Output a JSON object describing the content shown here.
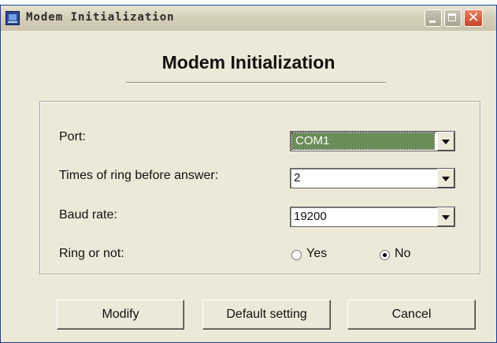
{
  "window": {
    "title": "Modem Initialization"
  },
  "heading": "Modem Initialization",
  "form": {
    "port": {
      "label": "Port:",
      "value": "COM1"
    },
    "rings": {
      "label": "Times of ring before answer:",
      "value": "2"
    },
    "baud": {
      "label": "Baud rate:",
      "value": "19200"
    },
    "ring": {
      "label": "Ring or not:",
      "yes_label": "Yes",
      "no_label": "No",
      "selected": "No"
    }
  },
  "buttons": {
    "modify": "Modify",
    "default": "Default setting",
    "cancel": "Cancel"
  },
  "icons": {
    "app": "modem-app-icon",
    "minimize": "minimize-icon",
    "maximize": "maximize-icon",
    "close": "close-icon",
    "dropdown": "chevron-down-icon"
  }
}
